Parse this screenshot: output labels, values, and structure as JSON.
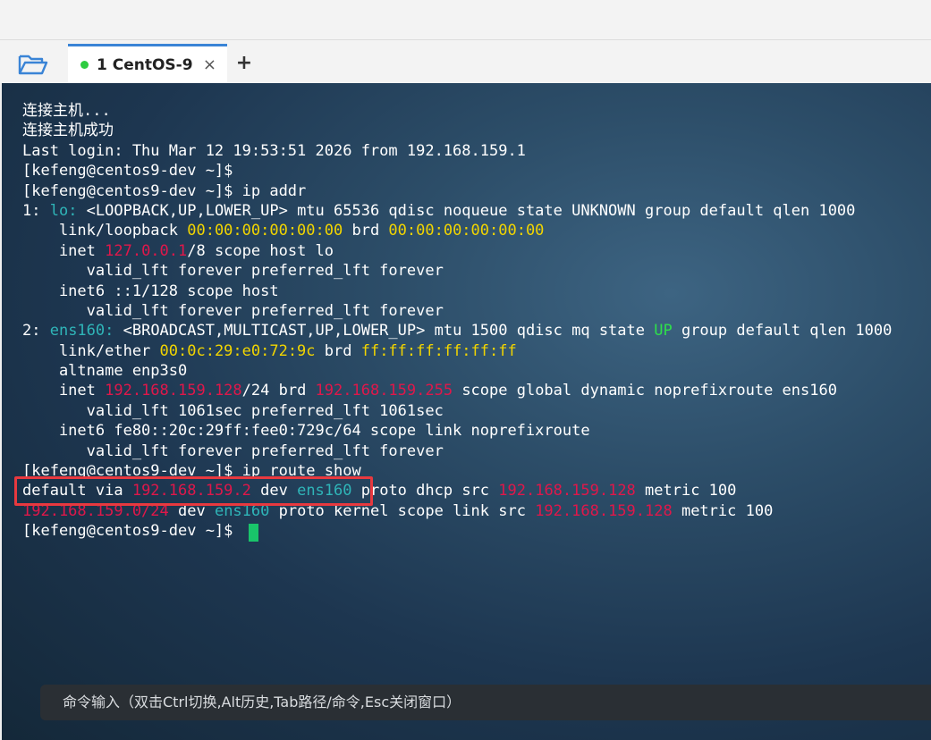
{
  "tab": {
    "label": "1 CentOS-9",
    "status_color": "#2ecc40",
    "close": "×"
  },
  "toolbar": {
    "add_label": "+",
    "folder_icon": "folder-open-icon"
  },
  "terminal": {
    "lines": [
      [
        {
          "t": "连接主机...",
          "c": ""
        }
      ],
      [
        {
          "t": "连接主机成功",
          "c": ""
        }
      ],
      [
        {
          "t": "Last login: Thu Mar 12 19:53:51 2026 from 192.168.159.1",
          "c": ""
        }
      ],
      [
        {
          "t": "[kefeng@centos9-dev ~]$",
          "c": ""
        }
      ],
      [
        {
          "t": "[kefeng@centos9-dev ~]$ ip addr",
          "c": ""
        }
      ],
      [
        {
          "t": "1: ",
          "c": ""
        },
        {
          "t": "lo:",
          "c": "cyan"
        },
        {
          "t": " <LOOPBACK,UP,LOWER_UP> mtu 65536 qdisc noqueue state UNKNOWN group default qlen 1000",
          "c": ""
        }
      ],
      [
        {
          "t": "    link/loopback ",
          "c": ""
        },
        {
          "t": "00:00:00:00:00:00",
          "c": "yellow"
        },
        {
          "t": " brd ",
          "c": ""
        },
        {
          "t": "00:00:00:00:00:00",
          "c": "yellow"
        }
      ],
      [
        {
          "t": "    inet ",
          "c": ""
        },
        {
          "t": "127.0.0.1",
          "c": "red"
        },
        {
          "t": "/8 scope host lo",
          "c": ""
        }
      ],
      [
        {
          "t": "       valid_lft forever preferred_lft forever",
          "c": ""
        }
      ],
      [
        {
          "t": "    inet6 ::1/128 scope host",
          "c": ""
        }
      ],
      [
        {
          "t": "       valid_lft forever preferred_lft forever",
          "c": ""
        }
      ],
      [
        {
          "t": "2: ",
          "c": ""
        },
        {
          "t": "ens160:",
          "c": "cyan"
        },
        {
          "t": " <BROADCAST,MULTICAST,UP,LOWER_UP> mtu 1500 qdisc mq state ",
          "c": ""
        },
        {
          "t": "UP",
          "c": "green"
        },
        {
          "t": " group default qlen 1000",
          "c": ""
        }
      ],
      [
        {
          "t": "    link/ether ",
          "c": ""
        },
        {
          "t": "00:0c:29:e0:72:9c",
          "c": "yellow"
        },
        {
          "t": " brd ",
          "c": ""
        },
        {
          "t": "ff:ff:ff:ff:ff:ff",
          "c": "yellow"
        }
      ],
      [
        {
          "t": "    altname enp3s0",
          "c": ""
        }
      ],
      [
        {
          "t": "    inet ",
          "c": ""
        },
        {
          "t": "192.168.159.128",
          "c": "red"
        },
        {
          "t": "/24 brd ",
          "c": ""
        },
        {
          "t": "192.168.159.255",
          "c": "red"
        },
        {
          "t": " scope global dynamic noprefixroute ens160",
          "c": ""
        }
      ],
      [
        {
          "t": "       valid_lft 1061sec preferred_lft 1061sec",
          "c": ""
        }
      ],
      [
        {
          "t": "    inet6 fe80::20c:29ff:fee0:729c/64 scope link noprefixroute",
          "c": ""
        }
      ],
      [
        {
          "t": "       valid_lft forever preferred_lft forever",
          "c": ""
        }
      ],
      [
        {
          "t": "[kefeng@centos9-dev ~]$ ip route show",
          "c": ""
        }
      ],
      [
        {
          "t": "default via ",
          "c": ""
        },
        {
          "t": "192.168.159.2",
          "c": "red"
        },
        {
          "t": " dev ",
          "c": ""
        },
        {
          "t": "ens160",
          "c": "cyan"
        },
        {
          "t": " proto dhcp src ",
          "c": ""
        },
        {
          "t": "192.168.159.128",
          "c": "red"
        },
        {
          "t": " metric 100",
          "c": ""
        }
      ],
      [
        {
          "t": "192.168.159.0/24",
          "c": "red"
        },
        {
          "t": " dev ",
          "c": ""
        },
        {
          "t": "ens160",
          "c": "cyan"
        },
        {
          "t": " proto kernel scope link src ",
          "c": ""
        },
        {
          "t": "192.168.159.128",
          "c": "red"
        },
        {
          "t": " metric 100",
          "c": ""
        }
      ],
      [
        {
          "t": "[kefeng@centos9-dev ~]$ ",
          "c": ""
        }
      ]
    ],
    "cursor_color": "#19c46a"
  },
  "command_bar": {
    "hint": "命令输入（双击Ctrl切换,Alt历史,Tab路径/命令,Esc关闭窗口）"
  },
  "colors": {
    "red": "#e0174a",
    "yellow": "#f2d500",
    "cyan": "#2fb5b8",
    "green": "#2ee04a",
    "highlight": "#e8393f"
  }
}
